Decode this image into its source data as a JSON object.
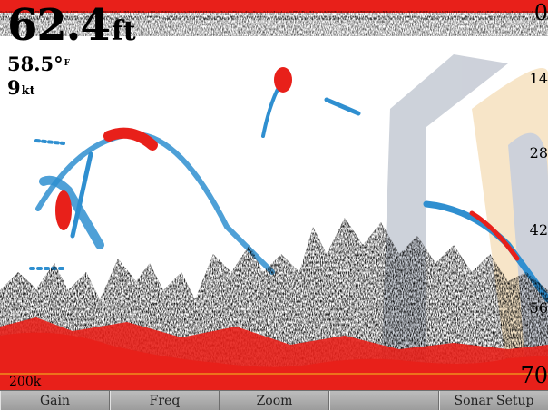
{
  "readouts": {
    "depth_value": "62.4",
    "depth_unit": "ft",
    "temperature_value": "58.5°",
    "temperature_unit": "F",
    "speed_value": "9",
    "speed_unit": "kt"
  },
  "depth_scale": {
    "top": "0",
    "mark_14": "14",
    "mark_28": "28",
    "mark_42": "42",
    "mark_56": "56",
    "bottom": "70"
  },
  "frequency_label": "200k",
  "softkeys": [
    {
      "label": "Gain"
    },
    {
      "label": "Freq"
    },
    {
      "label": "Zoom"
    },
    {
      "label": ""
    },
    {
      "label": "Sonar Setup"
    }
  ],
  "colors": {
    "strong_return": "#e8201a",
    "medium_return": "#f2c41e",
    "weak_return": "#2f8fd0",
    "background": "#ffffff",
    "watermark_gray": "#c8cdd6",
    "watermark_orange": "#f3d7a8",
    "softkey_bg": "#aaaaaa"
  }
}
